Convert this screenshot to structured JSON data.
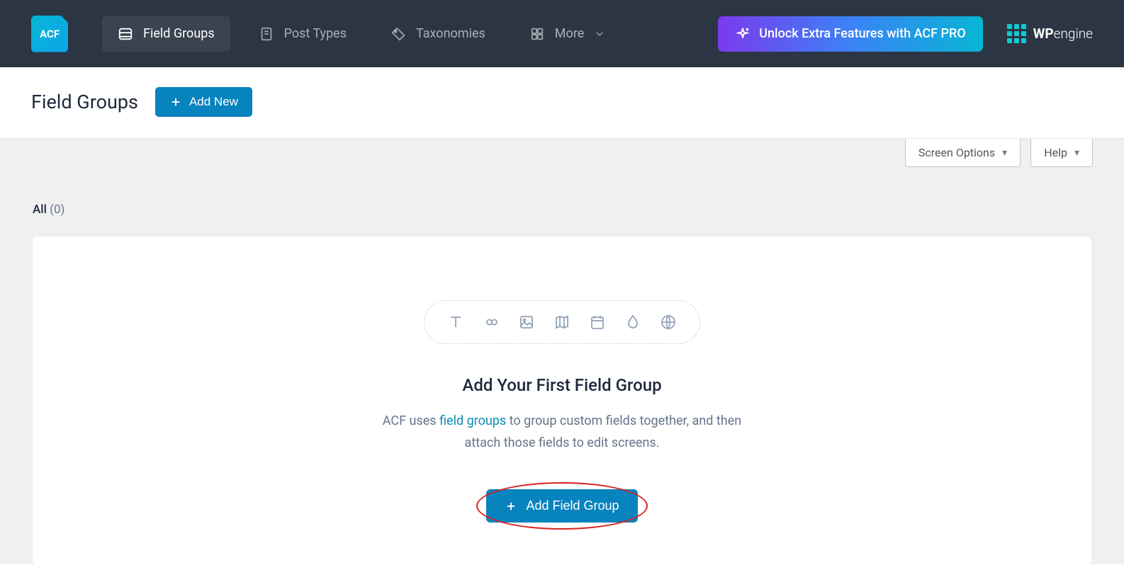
{
  "brand": {
    "logo_text": "ACF"
  },
  "wpengine": {
    "bold": "WP",
    "light": "engine"
  },
  "topnav": {
    "items": [
      {
        "label": "Field Groups"
      },
      {
        "label": "Post Types"
      },
      {
        "label": "Taxonomies"
      },
      {
        "label": "More"
      }
    ],
    "pro_button": "Unlock Extra Features with ACF PRO"
  },
  "page": {
    "title": "Field Groups",
    "add_new": "Add New"
  },
  "toggles": {
    "screen_options": "Screen Options",
    "help": "Help"
  },
  "filter": {
    "all_label": "All",
    "count": "(0)"
  },
  "empty": {
    "title": "Add Your First Field Group",
    "desc_pre": "ACF uses ",
    "desc_link": "field groups",
    "desc_post": " to group custom fields together, and then attach those fields to edit screens.",
    "button": "Add Field Group"
  }
}
